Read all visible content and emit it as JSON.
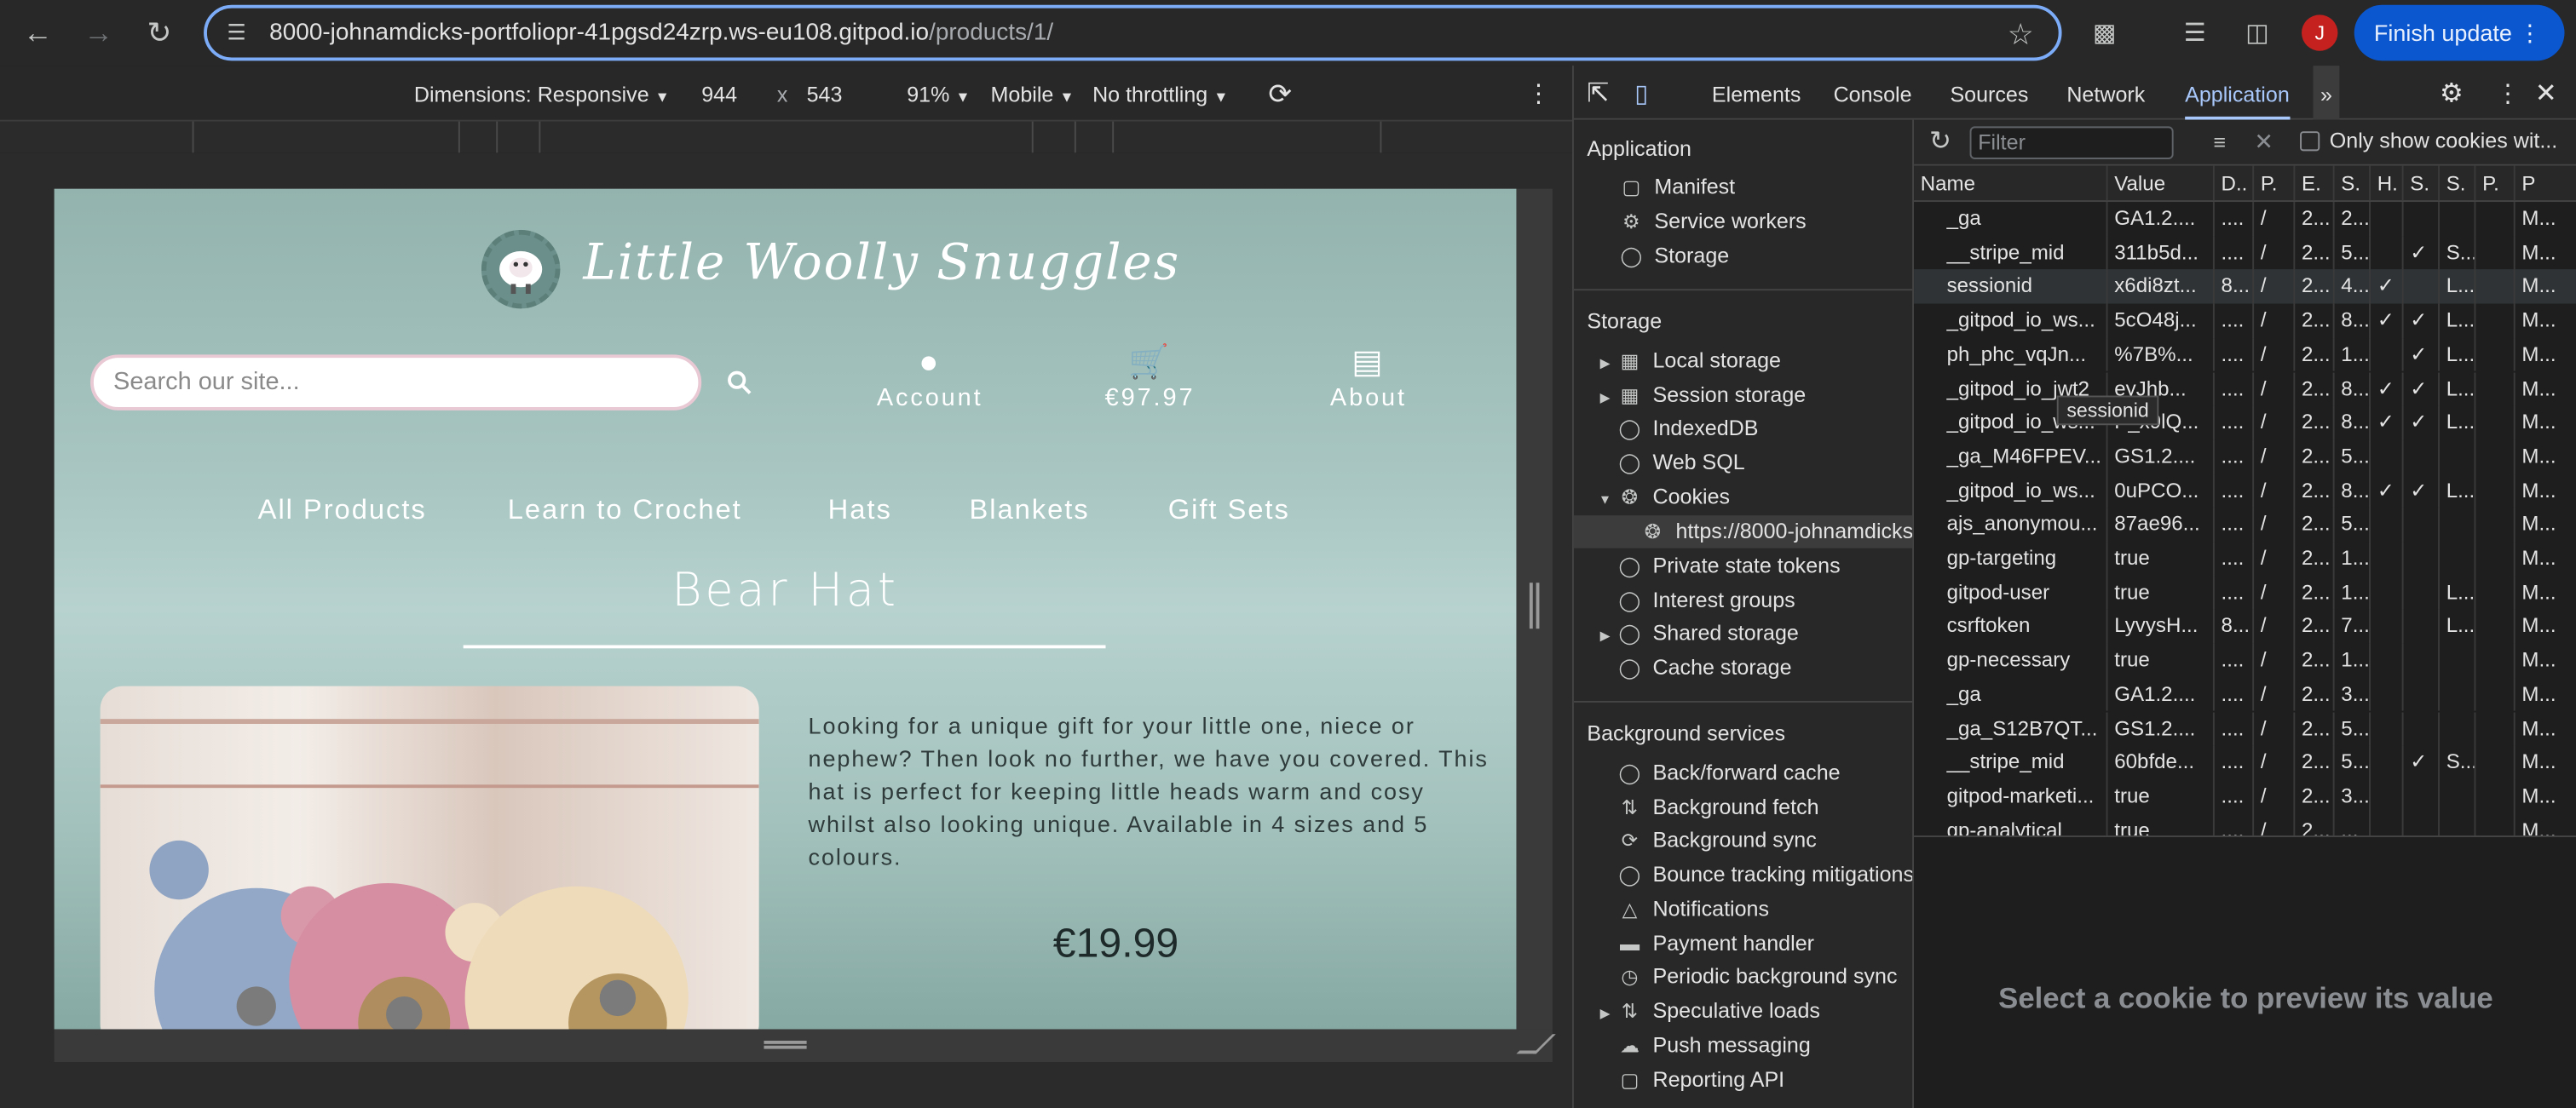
{
  "browser": {
    "url_host": "8000-johnamdicks-portfoliopr-41pgsd24zrp.ws-eu108.gitpod.io",
    "url_path": "/products/1/",
    "avatar_letter": "J",
    "finish_update": "Finish update"
  },
  "device_toolbar": {
    "dimensions": "Dimensions: Responsive",
    "width": "944",
    "times": "x",
    "height": "543",
    "zoom": "91%",
    "device": "Mobile",
    "throttling": "No throttling"
  },
  "site": {
    "brand": "Little Woolly Snuggles",
    "search_placeholder": "Search our site...",
    "account_label": "Account",
    "cart_total": "€97.97",
    "about_label": "About",
    "menu": [
      "All Products",
      "Learn to Crochet",
      "Hats",
      "Blankets",
      "Gift Sets"
    ],
    "product_title": "Bear Hat",
    "description": "Looking for a unique gift for your little one, niece or nephew? Then look no further, we have you covered. This hat is perfect for keeping little heads warm and cosy whilst also looking unique. Available in 4 sizes and 5 colours.",
    "price": "€19.99"
  },
  "devtools": {
    "tabs": [
      "Elements",
      "Console",
      "Sources",
      "Network",
      "Application"
    ],
    "active_tab": "Application",
    "filter_placeholder": "Filter",
    "only_show_label": "Only show cookies wit...",
    "sidebar": {
      "application_header": "Application",
      "application_items": [
        "Manifest",
        "Service workers",
        "Storage"
      ],
      "storage_header": "Storage",
      "storage_items": [
        "Local storage",
        "Session storage",
        "IndexedDB",
        "Web SQL",
        "Cookies",
        "https://8000-johnamdicks",
        "Private state tokens",
        "Interest groups",
        "Shared storage",
        "Cache storage"
      ],
      "background_header": "Background services",
      "background_items": [
        "Back/forward cache",
        "Background fetch",
        "Background sync",
        "Bounce tracking mitigations",
        "Notifications",
        "Payment handler",
        "Periodic background sync",
        "Speculative loads",
        "Push messaging",
        "Reporting API"
      ]
    },
    "columns": [
      "Name",
      "Value",
      "D..",
      "P.",
      "E.",
      "S.",
      "H.",
      "S.",
      "S.",
      "P.",
      "P"
    ],
    "cookies": [
      [
        "_ga",
        "GA1.2....",
        "....",
        "/",
        "2...",
        "2...",
        "",
        "",
        "",
        "",
        "M..."
      ],
      [
        "__stripe_mid",
        "311b5d...",
        "....",
        "/",
        "2...",
        "5...",
        "",
        "✓",
        "S...",
        "",
        "M..."
      ],
      [
        "sessionid",
        "x6di8zt...",
        "8...",
        "/",
        "2...",
        "4...",
        "✓",
        "",
        "L...",
        "",
        "M..."
      ],
      [
        "_gitpod_io_ws...",
        "5cO48j...",
        "....",
        "/",
        "2...",
        "8...",
        "✓",
        "✓",
        "L...",
        "",
        "M..."
      ],
      [
        "ph_phc_vqJn...",
        "%7B%...",
        "....",
        "/",
        "2...",
        "1...",
        "",
        "✓",
        "L...",
        "",
        "M..."
      ],
      [
        "_gitpod_io_jwt2_",
        "eyJhb...",
        "....",
        "/",
        "2...",
        "8...",
        "✓",
        "✓",
        "L...",
        "",
        "M..."
      ],
      [
        "_gitpod_io_ws...",
        "P_x9lQ...",
        "....",
        "/",
        "2...",
        "8...",
        "✓",
        "✓",
        "L...",
        "",
        "M..."
      ],
      [
        "_ga_M46FPEV...",
        "GS1.2....",
        "....",
        "/",
        "2...",
        "5...",
        "",
        "",
        "",
        "",
        "M..."
      ],
      [
        "_gitpod_io_ws...",
        "0uPCO...",
        "....",
        "/",
        "2...",
        "8...",
        "✓",
        "✓",
        "L...",
        "",
        "M..."
      ],
      [
        "ajs_anonymou...",
        "87ae96...",
        "....",
        "/",
        "2...",
        "5...",
        "",
        "",
        "",
        "",
        "M..."
      ],
      [
        "gp-targeting",
        "true",
        "....",
        "/",
        "2...",
        "1...",
        "",
        "",
        "",
        "",
        "M..."
      ],
      [
        "gitpod-user",
        "true",
        "....",
        "/",
        "2...",
        "1...",
        "",
        "",
        "L...",
        "",
        "M..."
      ],
      [
        "csrftoken",
        "LyvysH...",
        "8...",
        "/",
        "2...",
        "7...",
        "",
        "",
        "L...",
        "",
        "M..."
      ],
      [
        "gp-necessary",
        "true",
        "....",
        "/",
        "2...",
        "1...",
        "",
        "",
        "",
        "",
        "M..."
      ],
      [
        "_ga",
        "GA1.2....",
        "....",
        "/",
        "2...",
        "3...",
        "",
        "",
        "",
        "",
        "M..."
      ],
      [
        "_ga_S12B7QT...",
        "GS1.2....",
        "....",
        "/",
        "2...",
        "5...",
        "",
        "",
        "",
        "",
        "M..."
      ],
      [
        "__stripe_mid",
        "60bfde...",
        "....",
        "/",
        "2...",
        "5...",
        "",
        "✓",
        "S...",
        "",
        "M..."
      ],
      [
        "gitpod-marketi...",
        "true",
        "....",
        "/",
        "2...",
        "3...",
        "",
        "",
        "",
        "",
        "M..."
      ],
      [
        "gp-analytical",
        "true",
        "....",
        "/",
        "2...",
        "...",
        "",
        "",
        "",
        "",
        "M..."
      ]
    ],
    "tooltip": "sessionid",
    "preview_text": "Select a cookie to preview its value"
  }
}
